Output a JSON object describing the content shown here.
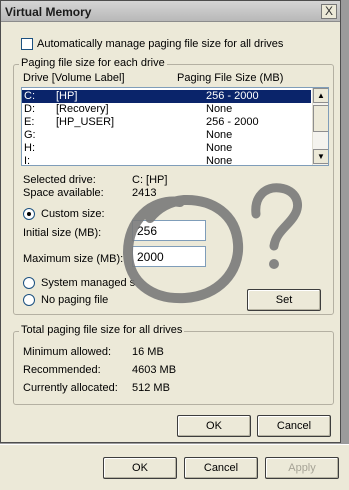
{
  "dialog": {
    "title": "Virtual Memory",
    "close_glyph": "X",
    "auto_manage": {
      "label": "Automatically manage paging file size for all drives",
      "checked": false
    },
    "paging_group": {
      "title": "Paging file size for each drive",
      "col_drive": "Drive  [Volume Label]",
      "col_size": "Paging File Size (MB)",
      "drives": [
        {
          "drive": "C:",
          "label": "[HP]",
          "size": "256 - 2000",
          "selected": true
        },
        {
          "drive": "D:",
          "label": "[Recovery]",
          "size": "None",
          "selected": false
        },
        {
          "drive": "E:",
          "label": "[HP_USER]",
          "size": "256 - 2000",
          "selected": false
        },
        {
          "drive": "G:",
          "label": "",
          "size": "None",
          "selected": false
        },
        {
          "drive": "H:",
          "label": "",
          "size": "None",
          "selected": false
        },
        {
          "drive": "I:",
          "label": "",
          "size": "None",
          "selected": false
        }
      ],
      "selected_drive_label": "Selected drive:",
      "selected_drive_value": "C:  [HP]",
      "space_available_label": "Space available:",
      "space_available_value": "2413",
      "custom_size_label": "Custom size:",
      "initial_size_label": "Initial size (MB):",
      "initial_size_value": "256",
      "maximum_size_label": "Maximum size (MB):",
      "maximum_size_value": "2000",
      "system_managed_label": "System managed s",
      "no_paging_label": "No paging file",
      "set_label": "Set",
      "size_mode": "custom"
    },
    "total_group": {
      "title": "Total paging file size for all drives",
      "min_label": "Minimum allowed:",
      "min_value": "16 MB",
      "rec_label": "Recommended:",
      "rec_value": "4603 MB",
      "cur_label": "Currently allocated:",
      "cur_value": "512 MB"
    },
    "ok_label": "OK",
    "cancel_label": "Cancel"
  },
  "parent_dialog": {
    "ok_label": "OK",
    "cancel_label": "Cancel",
    "apply_label": "Apply"
  },
  "colors": {
    "dialog_bg": "#ece9d8",
    "selection": "#0a246a",
    "scribble": "#7a7a7a"
  }
}
